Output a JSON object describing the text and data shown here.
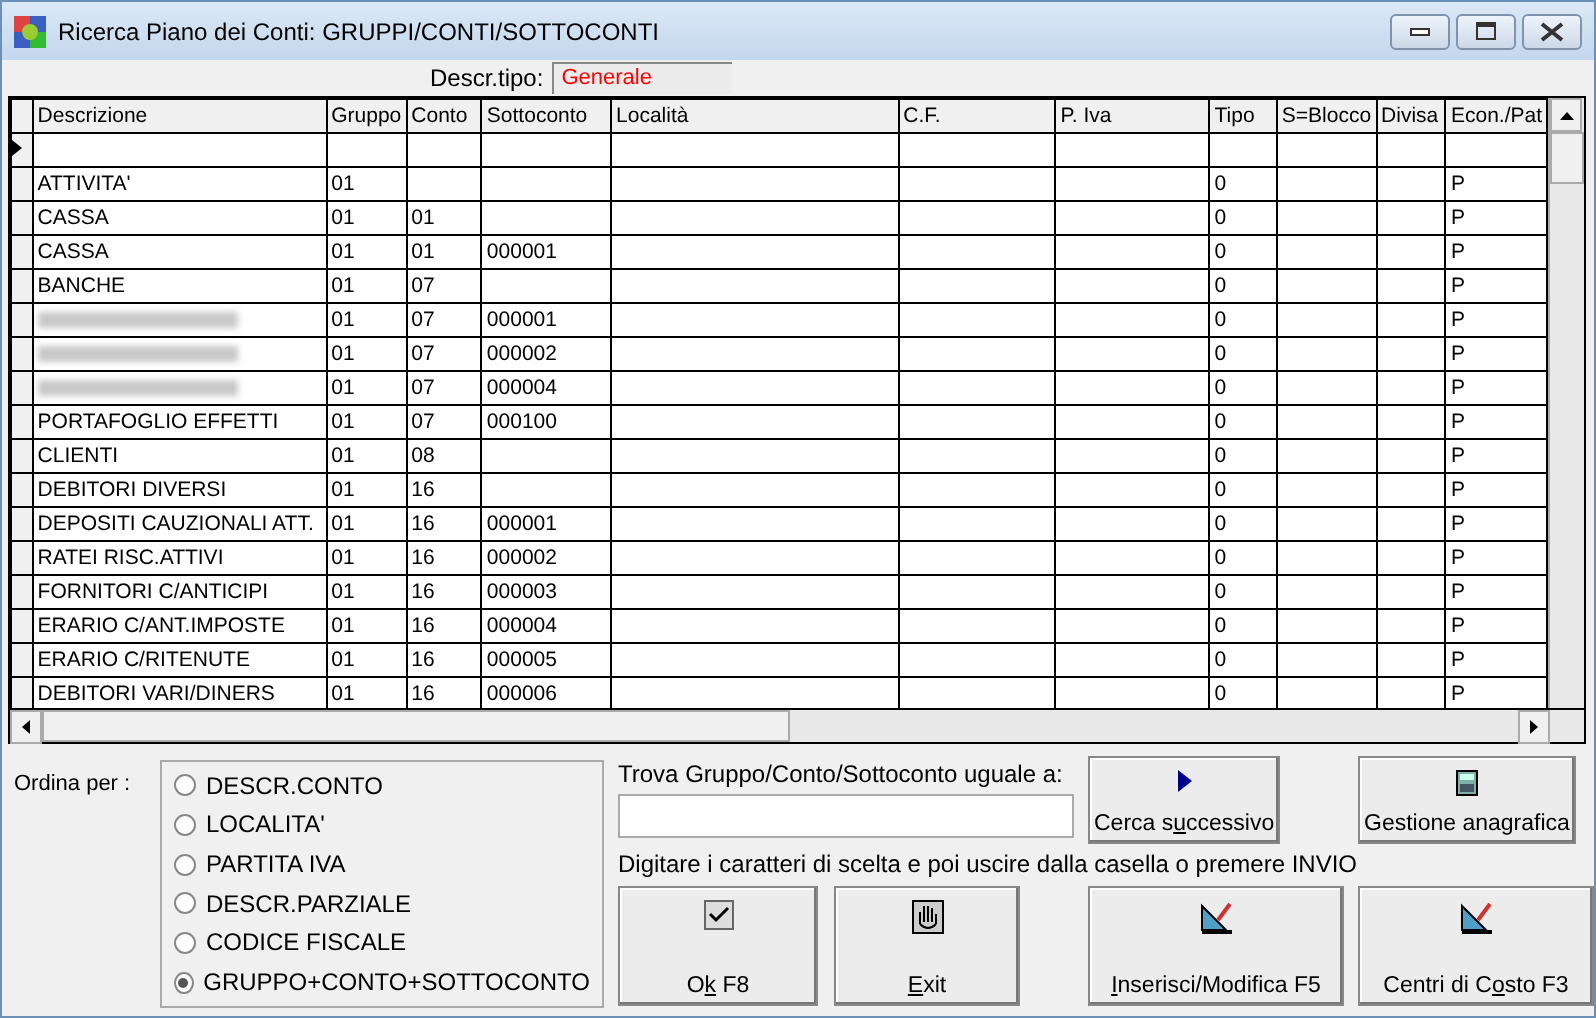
{
  "window": {
    "title": "Ricerca Piano dei Conti: GRUPPI/CONTI/SOTTOCONTI"
  },
  "descr_tipo": {
    "label": "Descr.tipo:",
    "value": "Generale"
  },
  "table": {
    "columns": [
      "Descrizione",
      "Gruppo",
      "Conto",
      "Sottoconto",
      "Località",
      "C.F.",
      "P. Iva",
      "Tipo",
      "S=Blocco",
      "Divisa",
      "Econ./Pat"
    ],
    "rows": [
      {
        "current": true,
        "redacted": false,
        "cells": [
          "",
          "",
          "",
          "",
          "",
          "",
          "",
          "",
          "",
          "",
          ""
        ]
      },
      {
        "current": false,
        "redacted": false,
        "cells": [
          "ATTIVITA'",
          "01",
          "",
          "",
          "",
          "",
          "",
          "0",
          "",
          "",
          "P"
        ]
      },
      {
        "current": false,
        "redacted": false,
        "cells": [
          "CASSA",
          "01",
          "01",
          "",
          "",
          "",
          "",
          "0",
          "",
          "",
          "P"
        ]
      },
      {
        "current": false,
        "redacted": false,
        "cells": [
          "CASSA",
          "01",
          "01",
          "000001",
          "",
          "",
          "",
          "0",
          "",
          "",
          "P"
        ]
      },
      {
        "current": false,
        "redacted": false,
        "cells": [
          "BANCHE",
          "01",
          "07",
          "",
          "",
          "",
          "",
          "0",
          "",
          "",
          "P"
        ]
      },
      {
        "current": false,
        "redacted": true,
        "cells": [
          "",
          "01",
          "07",
          "000001",
          "",
          "",
          "",
          "0",
          "",
          "",
          "P"
        ]
      },
      {
        "current": false,
        "redacted": true,
        "cells": [
          "",
          "01",
          "07",
          "000002",
          "",
          "",
          "",
          "0",
          "",
          "",
          "P"
        ]
      },
      {
        "current": false,
        "redacted": true,
        "cells": [
          "",
          "01",
          "07",
          "000004",
          "",
          "",
          "",
          "0",
          "",
          "",
          "P"
        ]
      },
      {
        "current": false,
        "redacted": false,
        "cells": [
          "PORTAFOGLIO EFFETTI",
          "01",
          "07",
          "000100",
          "",
          "",
          "",
          "0",
          "",
          "",
          "P"
        ]
      },
      {
        "current": false,
        "redacted": false,
        "cells": [
          "CLIENTI",
          "01",
          "08",
          "",
          "",
          "",
          "",
          "0",
          "",
          "",
          "P"
        ]
      },
      {
        "current": false,
        "redacted": false,
        "cells": [
          "DEBITORI DIVERSI",
          "01",
          "16",
          "",
          "",
          "",
          "",
          "0",
          "",
          "",
          "P"
        ]
      },
      {
        "current": false,
        "redacted": false,
        "cells": [
          "DEPOSITI CAUZIONALI ATT.",
          "01",
          "16",
          "000001",
          "",
          "",
          "",
          "0",
          "",
          "",
          "P"
        ]
      },
      {
        "current": false,
        "redacted": false,
        "cells": [
          "RATEI RISC.ATTIVI",
          "01",
          "16",
          "000002",
          "",
          "",
          "",
          "0",
          "",
          "",
          "P"
        ]
      },
      {
        "current": false,
        "redacted": false,
        "cells": [
          "FORNITORI C/ANTICIPI",
          "01",
          "16",
          "000003",
          "",
          "",
          "",
          "0",
          "",
          "",
          "P"
        ]
      },
      {
        "current": false,
        "redacted": false,
        "cells": [
          "ERARIO C/ANT.IMPOSTE",
          "01",
          "16",
          "000004",
          "",
          "",
          "",
          "0",
          "",
          "",
          "P"
        ]
      },
      {
        "current": false,
        "redacted": false,
        "cells": [
          "ERARIO C/RITENUTE",
          "01",
          "16",
          "000005",
          "",
          "",
          "",
          "0",
          "",
          "",
          "P"
        ]
      },
      {
        "current": false,
        "redacted": false,
        "cells": [
          "DEBITORI VARI/DINERS",
          "01",
          "16",
          "000006",
          "",
          "",
          "",
          "0",
          "",
          "",
          "P"
        ]
      }
    ]
  },
  "order_by": {
    "label": "Ordina per :",
    "options": [
      {
        "label": "DESCR.CONTO",
        "selected": false
      },
      {
        "label": "LOCALITA'",
        "selected": false
      },
      {
        "label": "PARTITA IVA",
        "selected": false
      },
      {
        "label": "DESCR.PARZIALE",
        "selected": false
      },
      {
        "label": "CODICE FISCALE",
        "selected": false
      },
      {
        "label": "GRUPPO+CONTO+SOTTOCONTO",
        "selected": true
      }
    ]
  },
  "find": {
    "label": "Trova Gruppo/Conto/Sottoconto uguale a:",
    "hint": "Digitare i caratteri di scelta e poi uscire dalla casella o premere INVIO"
  },
  "buttons": [
    {
      "kind": "next",
      "label": {
        "pre": "Cerca s",
        "key": "u",
        "post": "ccessivo"
      }
    },
    {
      "kind": "registry",
      "label": {
        "post": "Gestione anagrafica"
      }
    },
    {
      "kind": "ok",
      "label": {
        "pre": "O",
        "key": "k",
        "post": " F8"
      }
    },
    {
      "kind": "exit",
      "label": {
        "key": "E",
        "post": "xit"
      }
    },
    {
      "kind": "edit",
      "label": {
        "key": "I",
        "post": "nserisci/Modifica F5"
      }
    },
    {
      "kind": "costs",
      "label": {
        "pre": "Centri di C",
        "key": "o",
        "post": "sto F3"
      }
    }
  ]
}
